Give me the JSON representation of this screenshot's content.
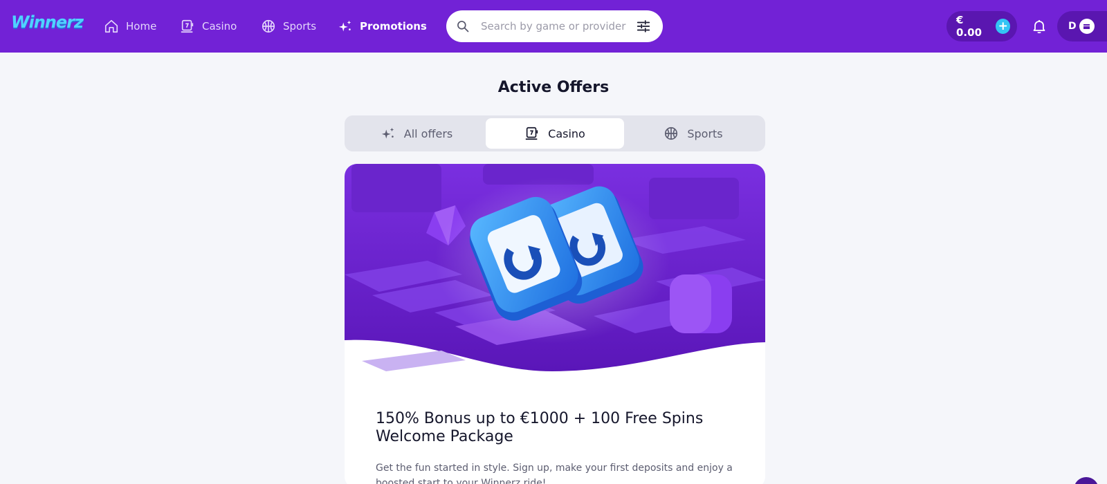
{
  "brand": {
    "logo_text": "Winnerz"
  },
  "nav": {
    "items": [
      {
        "label": "Home",
        "icon": "home-icon"
      },
      {
        "label": "Casino",
        "icon": "slot-machine-icon"
      },
      {
        "label": "Sports",
        "icon": "ball-icon"
      },
      {
        "label": "Promotions",
        "icon": "sparkles-icon",
        "active": true
      }
    ]
  },
  "search": {
    "placeholder": "Search by game or provider",
    "value": ""
  },
  "account": {
    "balance": "€ 0.00",
    "avatar_initial": "D"
  },
  "page": {
    "title": "Active Offers"
  },
  "tabs": [
    {
      "label": "All offers",
      "icon": "sparkles-icon"
    },
    {
      "label": "Casino",
      "icon": "slot-machine-icon",
      "active": true
    },
    {
      "label": "Sports",
      "icon": "ball-icon"
    }
  ],
  "offer": {
    "title": "150% Bonus up to €1000 + 100 Free Spins Welcome Package",
    "description": "Get the fun started in style. Sign up, make your first deposits and enjoy a boosted start to your Winnerz ride!"
  },
  "colors": {
    "header_bg": "#7222d6",
    "accent_cyan": "#33c4f4",
    "page_bg": "#f5f6fa"
  }
}
